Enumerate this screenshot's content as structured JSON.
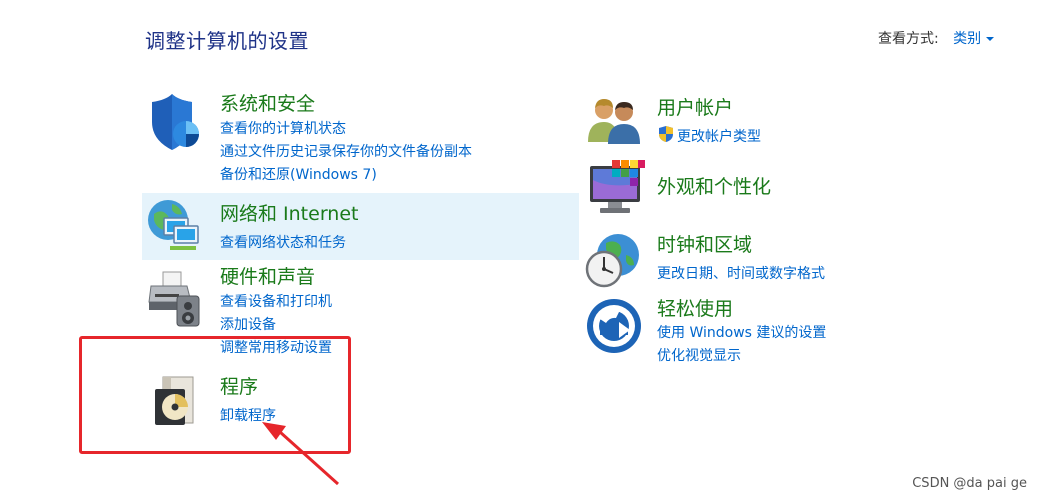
{
  "header": {
    "title": "调整计算机的设置",
    "view_by_label": "查看方式:",
    "view_by_value": "类别"
  },
  "left": {
    "system": {
      "title": "系统和安全",
      "links": [
        "查看你的计算机状态",
        "通过文件历史记录保存你的文件备份副本",
        "备份和还原(Windows 7)"
      ]
    },
    "network": {
      "title": "网络和 Internet",
      "links": [
        "查看网络状态和任务"
      ]
    },
    "hardware": {
      "title": "硬件和声音",
      "links": [
        "查看设备和打印机",
        "添加设备",
        "调整常用移动设置"
      ]
    },
    "programs": {
      "title": "程序",
      "links": [
        "卸载程序"
      ]
    }
  },
  "right": {
    "accounts": {
      "title": "用户帐户",
      "links": [
        "更改帐户类型"
      ]
    },
    "appearance": {
      "title": "外观和个性化"
    },
    "clock": {
      "title": "时钟和区域",
      "links": [
        "更改日期、时间或数字格式"
      ]
    },
    "ease": {
      "title": "轻松使用",
      "links": [
        "使用 Windows 建议的设置",
        "优化视觉显示"
      ]
    }
  },
  "watermark": "CSDN @da pai ge",
  "colors": {
    "title_green": "#1a7a1a",
    "link_blue": "#0066cc",
    "highlight_red": "#e6262b",
    "hover_bg": "#e5f3fb"
  }
}
